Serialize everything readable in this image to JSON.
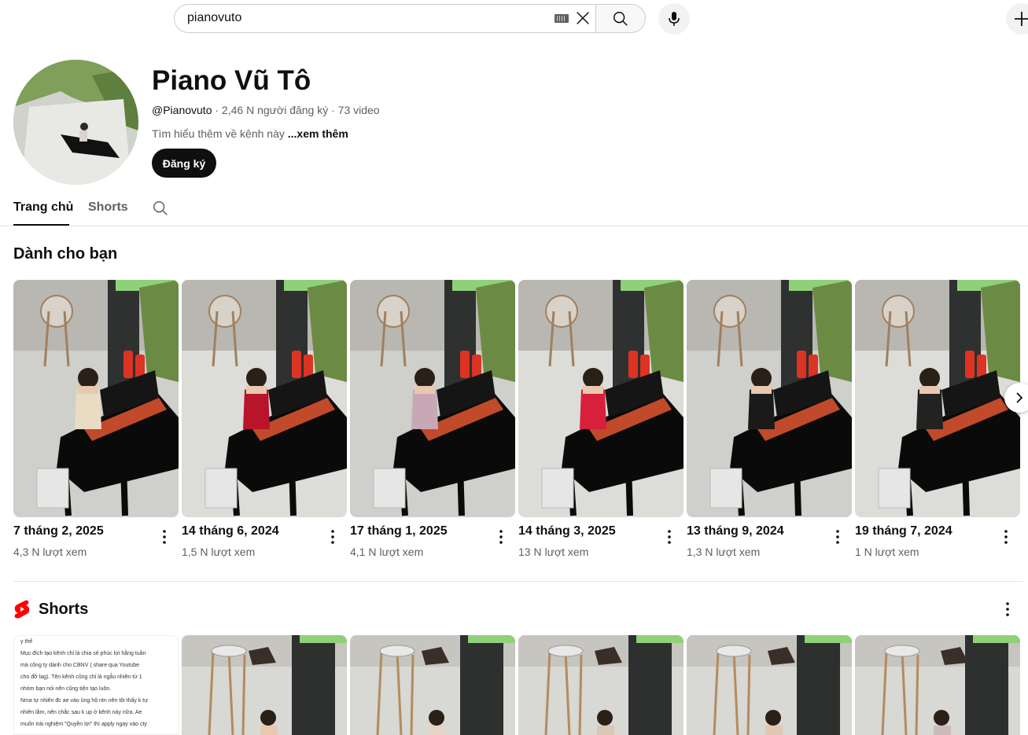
{
  "search": {
    "value": "pianovuto"
  },
  "channel": {
    "name": "Piano Vũ Tô",
    "handle": "@Pianovuto",
    "stats": " · 2,46 N người đăng ký · 73 video",
    "about": "Tìm hiểu thêm về kênh này ",
    "about_more": "...xem thêm",
    "subscribe_label": "Đăng ký"
  },
  "tabs": [
    {
      "label": "Trang chủ"
    },
    {
      "label": "Shorts"
    }
  ],
  "section_for_you": {
    "title": "Dành cho bạn",
    "videos": [
      {
        "title": "7 tháng 2, 2025",
        "views": "4,3 N lượt xem",
        "outfit": "#e9dcc3"
      },
      {
        "title": "14 tháng 6, 2024",
        "views": "1,5 N lượt xem",
        "outfit": "#b8142a"
      },
      {
        "title": "17 tháng 1, 2025",
        "views": "4,1 N lượt xem",
        "outfit": "#c9a8b6"
      },
      {
        "title": "14 tháng 3, 2025",
        "views": "13 N lượt xem",
        "outfit": "#d8203c"
      },
      {
        "title": "13 tháng 9, 2024",
        "views": "1,3 N lượt xem",
        "outfit": "#1a1a1a"
      },
      {
        "title": "19 tháng 7, 2024",
        "views": "1 N lượt xem",
        "outfit": "#222222"
      }
    ]
  },
  "shorts": {
    "title": "Shorts",
    "text_card": [
      "y thế",
      "Mục đích tạo kênh chỉ là chia sẻ phúc lợi hằng tuần",
      "mà công ty dành cho CBNV ( share qua Youtube",
      "cho đỡ lag). Tên kênh cũng chỉ là ngẫu nhiên từ 1",
      "nhóm bạn nói nên cũng tiện tạo luôn.",
      "Nma tự nhiên đc ae vào ủng hộ ntn nên tôi thấy k tự",
      "nhiên lắm, nên chắc sau k up ở kênh này nữa. Ae",
      "muốn trải nghiệm \"Quyền lợi\" thì apply ngay vào cty"
    ]
  },
  "colors": {
    "accent": "#ff0000",
    "text": "#0f0f0f",
    "secondary": "#606060"
  }
}
